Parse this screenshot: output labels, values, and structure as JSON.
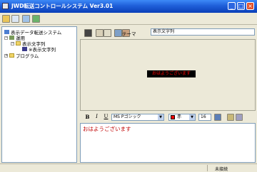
{
  "window": {
    "title": "JWD転送コントロールシステム Ver3.01",
    "controls": [
      "minimize",
      "maximize",
      "close"
    ]
  },
  "toolbar": {
    "icons": [
      "folder-open-icon",
      "open-file-icon",
      "network-icon",
      "transfer-icon"
    ]
  },
  "tree": {
    "root": "表示データ転送システム",
    "items": [
      {
        "label": "運用"
      },
      {
        "label": "表示文字列"
      },
      {
        "label": "※表示文字列"
      },
      {
        "label": "プログラム"
      }
    ]
  },
  "editor_toolbar": {
    "theme_label": "テーマ",
    "theme_value": "表示文字列"
  },
  "preview": {
    "text": "おはようございます"
  },
  "format": {
    "bold": "B",
    "italic": "I",
    "underline": "U",
    "font": "MS Pゴシック",
    "color_name": "赤",
    "color_hex": "#ff0000",
    "size": "16"
  },
  "editor": {
    "content": "おはようございます"
  },
  "status": {
    "text": "未接続"
  }
}
